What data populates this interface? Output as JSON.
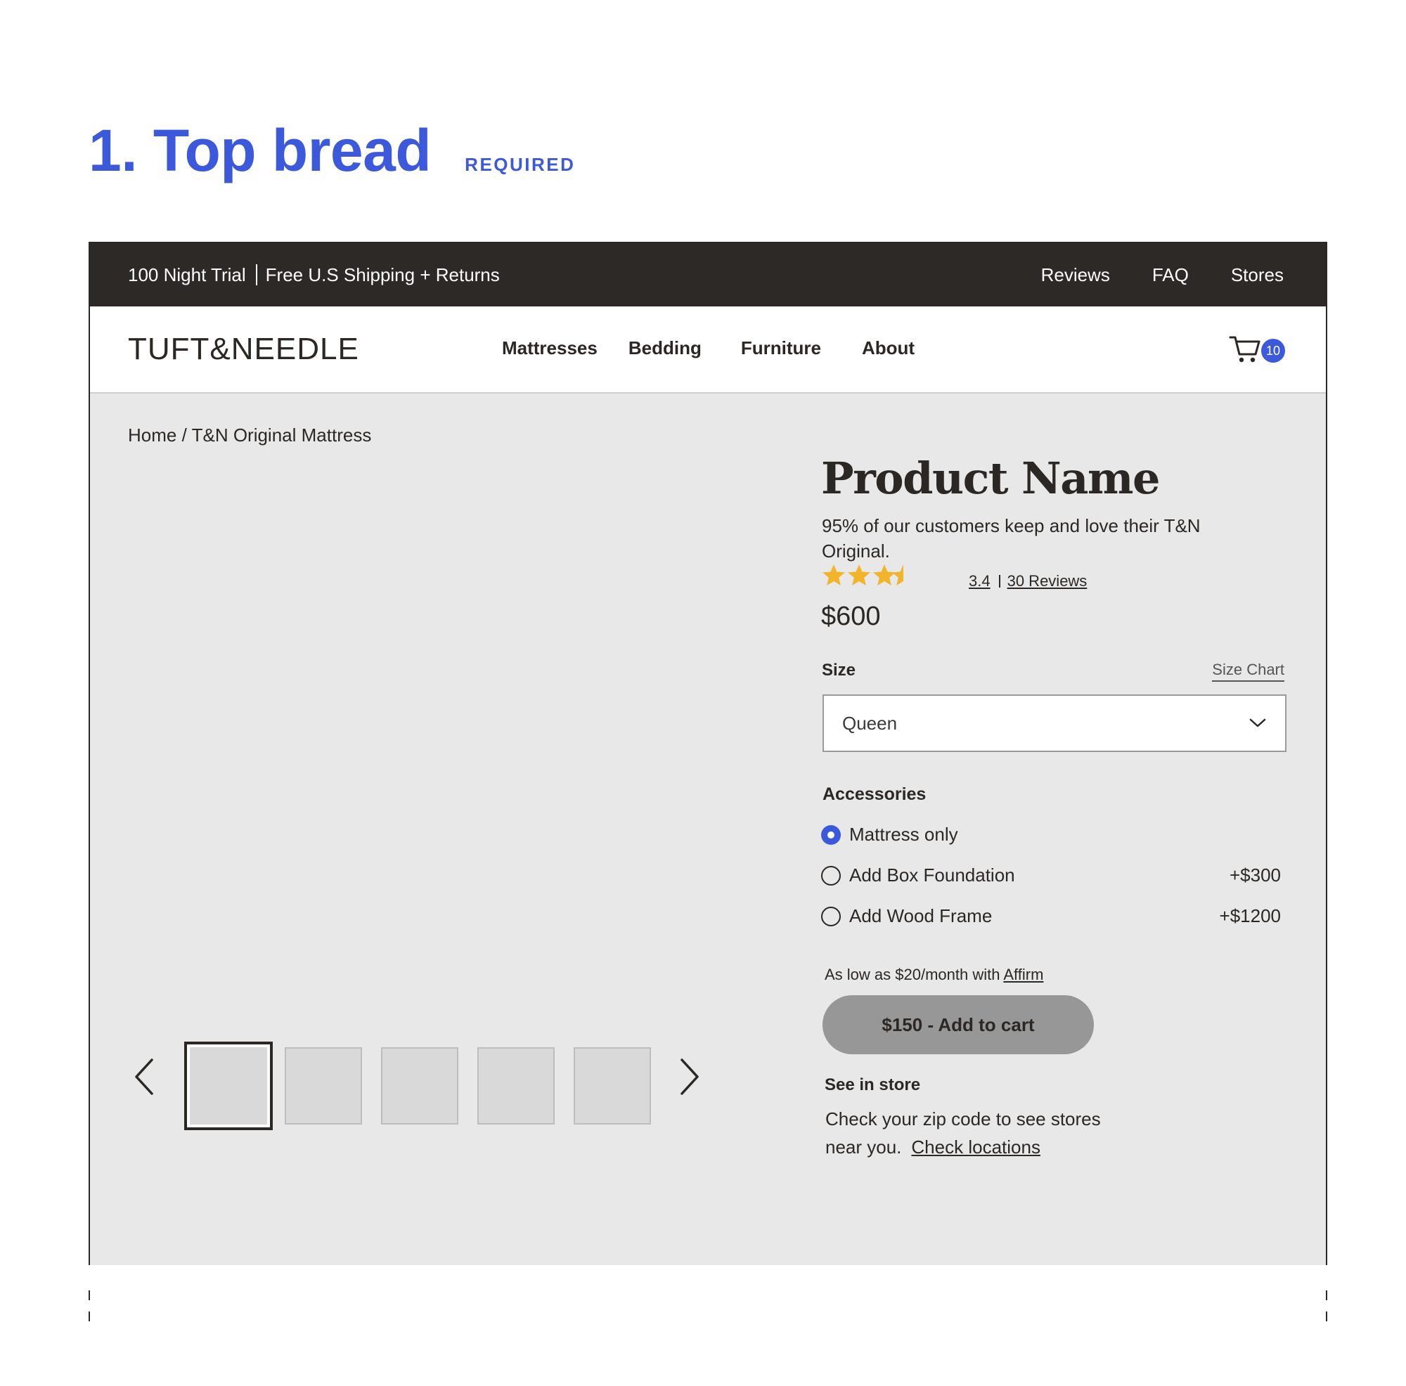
{
  "section": {
    "title": "1. Top bread",
    "tag": "REQUIRED"
  },
  "promo": {
    "left_1": "100 Night Trial",
    "left_2": "Free U.S Shipping + Returns",
    "links": [
      "Reviews",
      "FAQ",
      "Stores"
    ]
  },
  "header": {
    "logo": "TUFT&NEEDLE",
    "nav": [
      "Mattresses",
      "Bedding",
      "Furniture",
      "About"
    ],
    "cart_count": "10"
  },
  "breadcrumb": {
    "home": "Home",
    "separator": "/",
    "current": "T&N Original Mattress"
  },
  "gallery": {
    "thumb_count": 5,
    "active_index": 0
  },
  "product": {
    "name": "Product Name",
    "description": "95% of our customers keep and love their T&N Original.",
    "rating_value": "3.4",
    "reviews_label": "30 Reviews",
    "stars_filled": 3.5,
    "stars_total": 4,
    "price": "$600"
  },
  "size": {
    "label": "Size",
    "chart_link": "Size Chart",
    "selected": "Queen"
  },
  "accessories": {
    "label": "Accessories",
    "options": [
      {
        "label": "Mattress only",
        "price": "",
        "selected": true
      },
      {
        "label": "Add Box Foundation",
        "price": "+$300",
        "selected": false
      },
      {
        "label": "Add Wood Frame",
        "price": "+$1200",
        "selected": false
      }
    ]
  },
  "financing": {
    "text": "As low as $20/month with",
    "link": "Affirm"
  },
  "cart_button": {
    "label": "$150 - Add to cart"
  },
  "store": {
    "title": "See in store",
    "text_line1": "Check your zip code to see stores",
    "text_line2": "near you.",
    "link": "Check locations"
  },
  "colors": {
    "accent": "#3c59dc",
    "dark": "#2d2926",
    "star": "#f2b42b",
    "panel": "#e8e8e8",
    "button": "#979797"
  }
}
